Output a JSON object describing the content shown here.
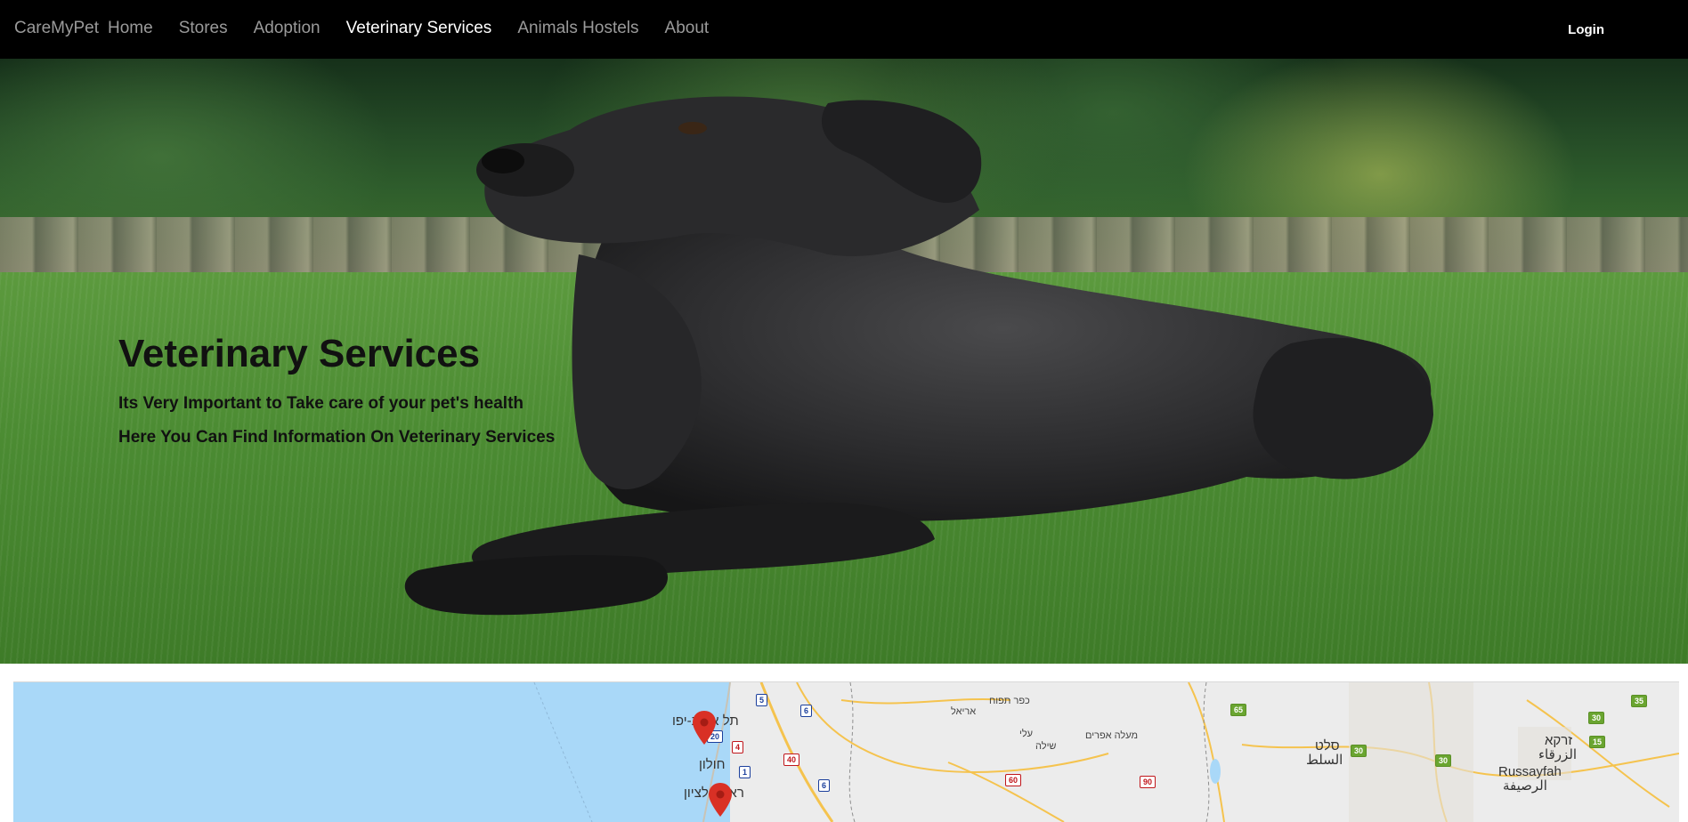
{
  "nav": {
    "brand": "CareMyPet",
    "links": [
      "Home",
      "Stores",
      "Adoption",
      "Veterinary Services",
      "Animals Hostels",
      "About"
    ],
    "active": "Veterinary Services",
    "login": "Login"
  },
  "hero": {
    "title": "Veterinary Services",
    "subtitle1": "Its Very Important to Take care of your pet's health",
    "subtitle2": "Here You Can Find Information On Veterinary Services"
  },
  "map": {
    "labels": [
      "תל אביב-יפו",
      "חולון",
      "ראשון לציון",
      "כפר תפוח",
      "אריאל",
      "עלי",
      "שילה",
      "מעלה אפרים",
      "סלט",
      "السلط",
      "זרקא",
      "الزرقاء",
      "Russayfah",
      "الرصيفة"
    ],
    "road_badges": {
      "blue": [
        "5",
        "6",
        "20",
        "1",
        "6"
      ],
      "red": [
        "4",
        "40",
        "60",
        "90"
      ],
      "green": [
        "65",
        "35",
        "30",
        "15",
        "30",
        "30"
      ]
    },
    "colors": {
      "sea": "#a9d8f8",
      "land": "#ececec",
      "pin": "#d93025"
    }
  }
}
